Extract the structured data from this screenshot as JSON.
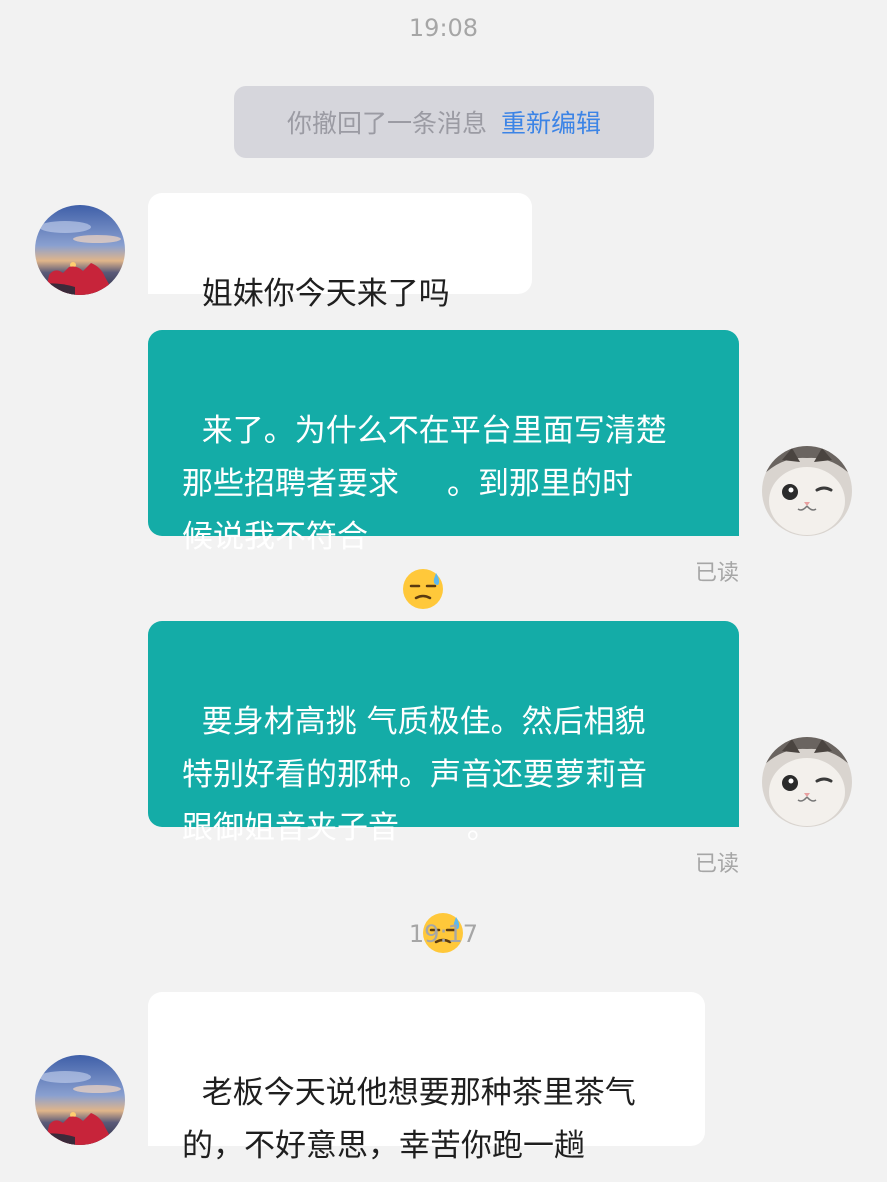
{
  "chat": {
    "timestamps": [
      "19:08",
      "19:17"
    ],
    "system_notice": {
      "text": "你撤回了一条消息",
      "action": "重新编辑"
    },
    "messages": [
      {
        "side": "incoming",
        "avatar": "sunset-avatar",
        "parts": [
          "姐妹你今天来了吗"
        ],
        "emoji": "tears-of-joy-emoji"
      },
      {
        "side": "outgoing",
        "avatar": "cat-avatar",
        "parts": [
          "来了。为什么不在平台里面写清楚\n那些招聘者要求",
          "。到那里的时\n候说我不符合"
        ],
        "emoji": "sweat-emoji",
        "status": "已读"
      },
      {
        "side": "outgoing",
        "avatar": "cat-avatar",
        "parts": [
          "要身材高挑 气质极佳。然后相貌\n特别好看的那种。声音还要萝莉音\n跟御姐音夹子音  ",
          "。"
        ],
        "emoji": "sweat-emoji",
        "status": "已读"
      },
      {
        "side": "incoming",
        "avatar": "sunset-avatar",
        "parts": [
          "老板今天说他想要那种茶里茶气\n的，不好意思，幸苦你跑一趟"
        ]
      }
    ]
  },
  "colors": {
    "background": "#f2f2f2",
    "outgoing_bubble": "#14aca7",
    "incoming_bubble": "#ffffff",
    "link": "#3c84e6",
    "muted_text": "#a6a6a6"
  }
}
